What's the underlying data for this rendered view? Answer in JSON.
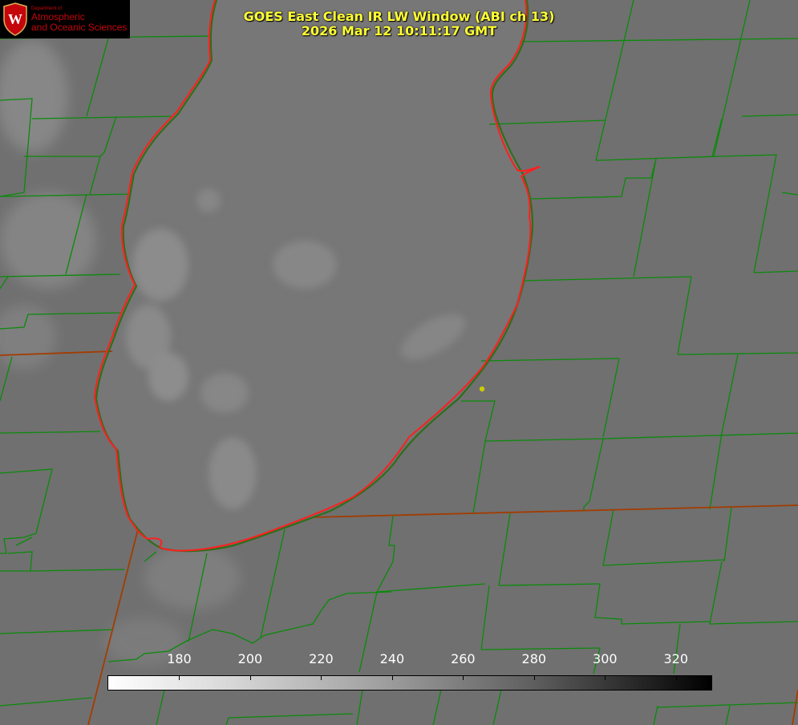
{
  "title": {
    "line1": "GOES East Clean IR LW Window (ABI ch 13)",
    "line2": "2026 Mar 12 10:11:17 GMT"
  },
  "logo": {
    "dept": "Department of",
    "line1": "Atmospheric",
    "line2": "and Oceanic Sciences",
    "crest_letter": "W",
    "color": "#c5050c"
  },
  "colorbar": {
    "min": 160,
    "max": 330,
    "ticks": [
      180,
      200,
      220,
      240,
      260,
      280,
      300,
      320
    ],
    "gradient": "white-to-black"
  },
  "colors": {
    "county_lines": "#0a8a0a",
    "lake_outline": "#ff2020",
    "state_border": "#cc3300",
    "title": "#ffff33",
    "marker": "#cccc00"
  },
  "features": {
    "lake": "lake-michigan-outline",
    "marker": "point-marker"
  }
}
